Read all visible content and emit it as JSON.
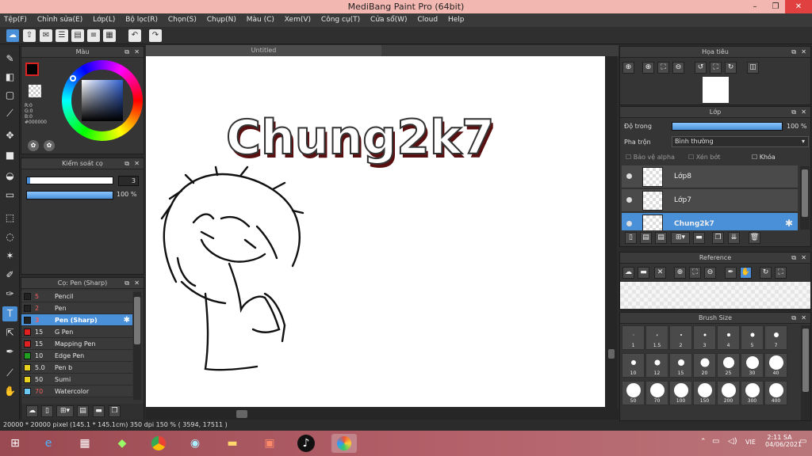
{
  "window": {
    "title": "MediBang Paint Pro (64bit)",
    "min": "–",
    "max": "❐",
    "close": "✕"
  },
  "menu": [
    "Tệp(F)",
    "Chỉnh sửa(E)",
    "Lớp(L)",
    "Bộ lọc(R)",
    "Chọn(S)",
    "Chụp(N)",
    "Màu (C)",
    "Xem(V)",
    "Công cụ(T)",
    "Cửa sổ(W)",
    "Cloud",
    "Help"
  ],
  "color_panel": {
    "title": "Màu",
    "r": "R:0",
    "g": "G:0",
    "b": "B:0",
    "hex": "#000000"
  },
  "brush_control": {
    "title": "Kiểm soát cọ",
    "size": "3",
    "opacity": "100 %"
  },
  "brush_panel": {
    "title": "Cọ: Pen (Sharp)",
    "items": [
      {
        "size": "5",
        "name": "Pencil",
        "color": "#222222"
      },
      {
        "size": "2",
        "name": "Pen",
        "color": "#222222"
      },
      {
        "size": "3",
        "name": "Pen (Sharp)",
        "color": "#222222",
        "selected": true
      },
      {
        "size": "15",
        "name": "G Pen",
        "color": "#e02020"
      },
      {
        "size": "15",
        "name": "Mapping Pen",
        "color": "#e02020"
      },
      {
        "size": "10",
        "name": "Edge Pen",
        "color": "#20a020"
      },
      {
        "size": "5.0",
        "name": "Pen b",
        "color": "#e8d020"
      },
      {
        "size": "50",
        "name": "Sumi",
        "color": "#e8d020"
      },
      {
        "size": "70",
        "name": "Watercolor",
        "color": "#6cc8f0"
      }
    ]
  },
  "document": {
    "tab": "Untitled",
    "artwork_text": "Chung2k7"
  },
  "status": {
    "text": "20000 * 20000 pixel   (145.1 * 145.1cm)   350 dpi   150 %   ( 3594, 17511 )"
  },
  "navigator": {
    "title": "Họa tiêu"
  },
  "layer_panel": {
    "title": "Lớp",
    "opacity_label": "Độ trong",
    "opacity_value": "100 %",
    "opacity": 1.0,
    "blend_label": "Pha trộn",
    "blend_value": "Bình thường",
    "protect_alpha": "Bảo vệ alpha",
    "clipping": "Xén bớt",
    "lock": "Khóa",
    "layers": [
      {
        "name": "Lớp8"
      },
      {
        "name": "Lớp7"
      },
      {
        "name": "Chung2k7",
        "selected": true
      }
    ]
  },
  "reference": {
    "title": "Reference"
  },
  "brush_size": {
    "title": "Brush Size",
    "sizes": [
      "1",
      "1.5",
      "2",
      "3",
      "4",
      "5",
      "7",
      "10",
      "12",
      "15",
      "20",
      "25",
      "30",
      "40",
      "50",
      "70",
      "100",
      "150",
      "200",
      "300",
      "400"
    ]
  },
  "taskbar": {
    "time": "2:11 SA",
    "date": "04/06/2021",
    "lang": "VIE"
  }
}
